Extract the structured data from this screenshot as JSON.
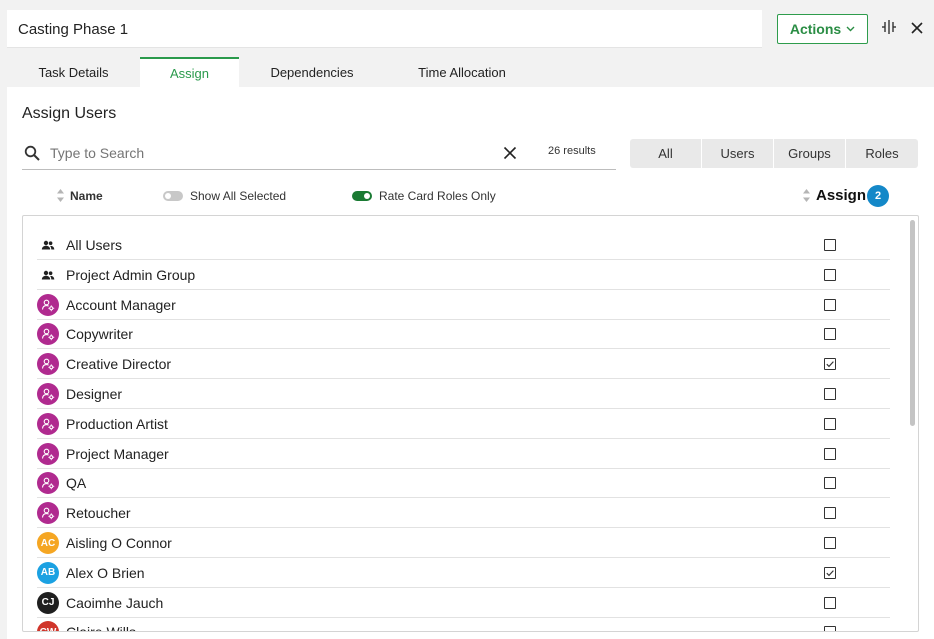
{
  "window": {
    "title": "Casting Phase 1",
    "actions_label": "Actions",
    "split_icon": "split-view-icon",
    "close_icon": "close-icon"
  },
  "tabs": [
    {
      "label": "Task Details",
      "active": false
    },
    {
      "label": "Assign",
      "active": true
    },
    {
      "label": "Dependencies",
      "active": false
    },
    {
      "label": "Time Allocation",
      "active": false
    }
  ],
  "assign": {
    "heading": "Assign Users",
    "search": {
      "placeholder": "Type to Search",
      "value": "",
      "results_text": "26 results"
    },
    "filters": [
      "All",
      "Users",
      "Groups",
      "Roles"
    ],
    "columns": {
      "name": "Name",
      "show_all_selected": {
        "label": "Show All Selected",
        "on": false
      },
      "rate_card_roles_only": {
        "label": "Rate Card Roles Only",
        "on": true
      },
      "assign": "Assign",
      "assign_count": "2"
    },
    "rows": [
      {
        "label": "All Users",
        "kind": "group",
        "checked": false
      },
      {
        "label": "Project Admin Group",
        "kind": "group",
        "checked": false
      },
      {
        "label": "Account Manager",
        "kind": "role",
        "checked": false
      },
      {
        "label": "Copywriter",
        "kind": "role",
        "checked": false
      },
      {
        "label": "Creative Director",
        "kind": "role",
        "checked": true
      },
      {
        "label": "Designer",
        "kind": "role",
        "checked": false
      },
      {
        "label": "Production Artist",
        "kind": "role",
        "checked": false
      },
      {
        "label": "Project Manager",
        "kind": "role",
        "checked": false
      },
      {
        "label": "QA",
        "kind": "role",
        "checked": false
      },
      {
        "label": "Retoucher",
        "kind": "role",
        "checked": false
      },
      {
        "label": "Aisling O Connor",
        "kind": "user",
        "initials": "AC",
        "color": "#f5a623",
        "checked": false
      },
      {
        "label": "Alex O Brien",
        "kind": "user",
        "initials": "AB",
        "color": "#1ba1e2",
        "checked": true
      },
      {
        "label": "Caoimhe Jauch",
        "kind": "user",
        "initials": "CJ",
        "color": "#1f1f1f",
        "checked": false
      },
      {
        "label": "Claire Wills",
        "kind": "user",
        "initials": "CW",
        "color": "#d0352a",
        "checked": false
      }
    ]
  },
  "colors": {
    "accent_green": "#2a9a4c",
    "badge_blue": "#1488c8",
    "role_purple": "#b02a8f",
    "toggle_on": "#1a7a33"
  }
}
